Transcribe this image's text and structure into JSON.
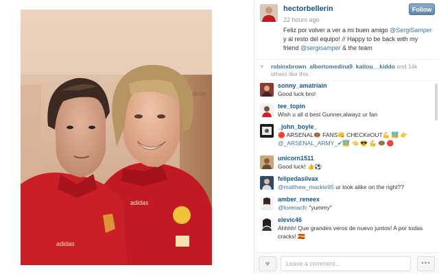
{
  "post": {
    "username": "hectorbellerin",
    "time_ago": "22 hours ago",
    "follow_label": "Follow",
    "caption_part1": "Feliz por volver a ver a mi buen amigo ",
    "caption_mention1": "@SergiSamper",
    "caption_part2": " y al resto del equipo! // Happy to be back with my friend ",
    "caption_mention2": "@sergisamper",
    "caption_part3": " & the team"
  },
  "likes": {
    "heart_icon": "heart-icon",
    "liker1": "robinxbrown",
    "liker2": "albertomedina9",
    "liker3": "kaitou__kiddo",
    "sep": ", ",
    "and_text": " and ",
    "count_text": "14k",
    "suffix": " others like this."
  },
  "comments": [
    {
      "user": "sonny_amatriain",
      "text": "Good luck bro!"
    },
    {
      "user": "tee_topin",
      "text": "Wish u all d best Gunner,alwayz ur fan"
    },
    {
      "user": "_john_boyle_",
      "text": "🔴 ARSENAL🍩 FANS👊 CHECK#OUT💪 🚟 👉",
      "text2": "@_ARSENAL_ARMY_✔🚟 👈 😎 💪 🍩 🔴"
    },
    {
      "user": "unicorn1511",
      "text": "Good luck! 👍⚽"
    },
    {
      "user": "felipedasilvax",
      "mention": "@matthew_mackie95",
      "text": " ur look alike on the right??"
    },
    {
      "user": "amber_reneex",
      "mention": "@lorenacfc",
      "text": " \"yummy\""
    },
    {
      "user": "elevic46",
      "text": "Ahhhh! Que grandes veros de nuevo juntos! A por todas",
      "text2": "cracks! 🇪🇸"
    }
  ],
  "footer": {
    "comment_placeholder": "Leave a comment...",
    "more_label": "•••"
  },
  "colors": {
    "link": "#125688",
    "mention": "#3f729b",
    "follow": "#6f97b6"
  }
}
